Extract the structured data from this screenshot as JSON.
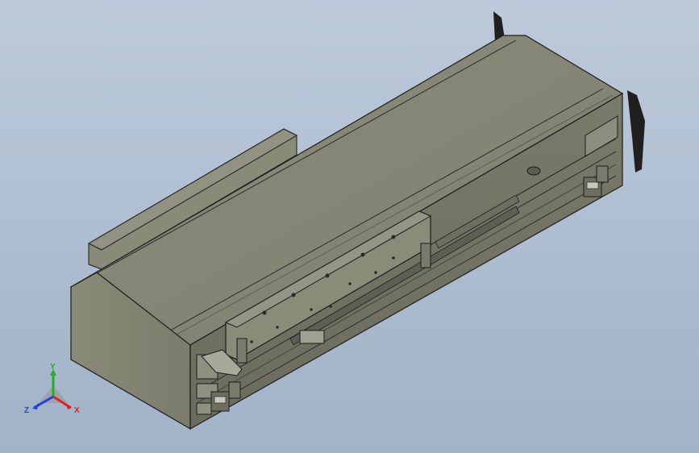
{
  "viewport": {
    "background_top": "#bccadb",
    "background_bottom": "#a2b3c8"
  },
  "model": {
    "name_icon": "linear-actuator-model",
    "body_color": "#8a8a78",
    "edge_color": "#1c1c1c"
  },
  "triad": {
    "x_label": "X",
    "y_label": "Y",
    "z_label": "Z",
    "x_color": "#e02020",
    "y_color": "#20b020",
    "z_color": "#2040e0"
  }
}
